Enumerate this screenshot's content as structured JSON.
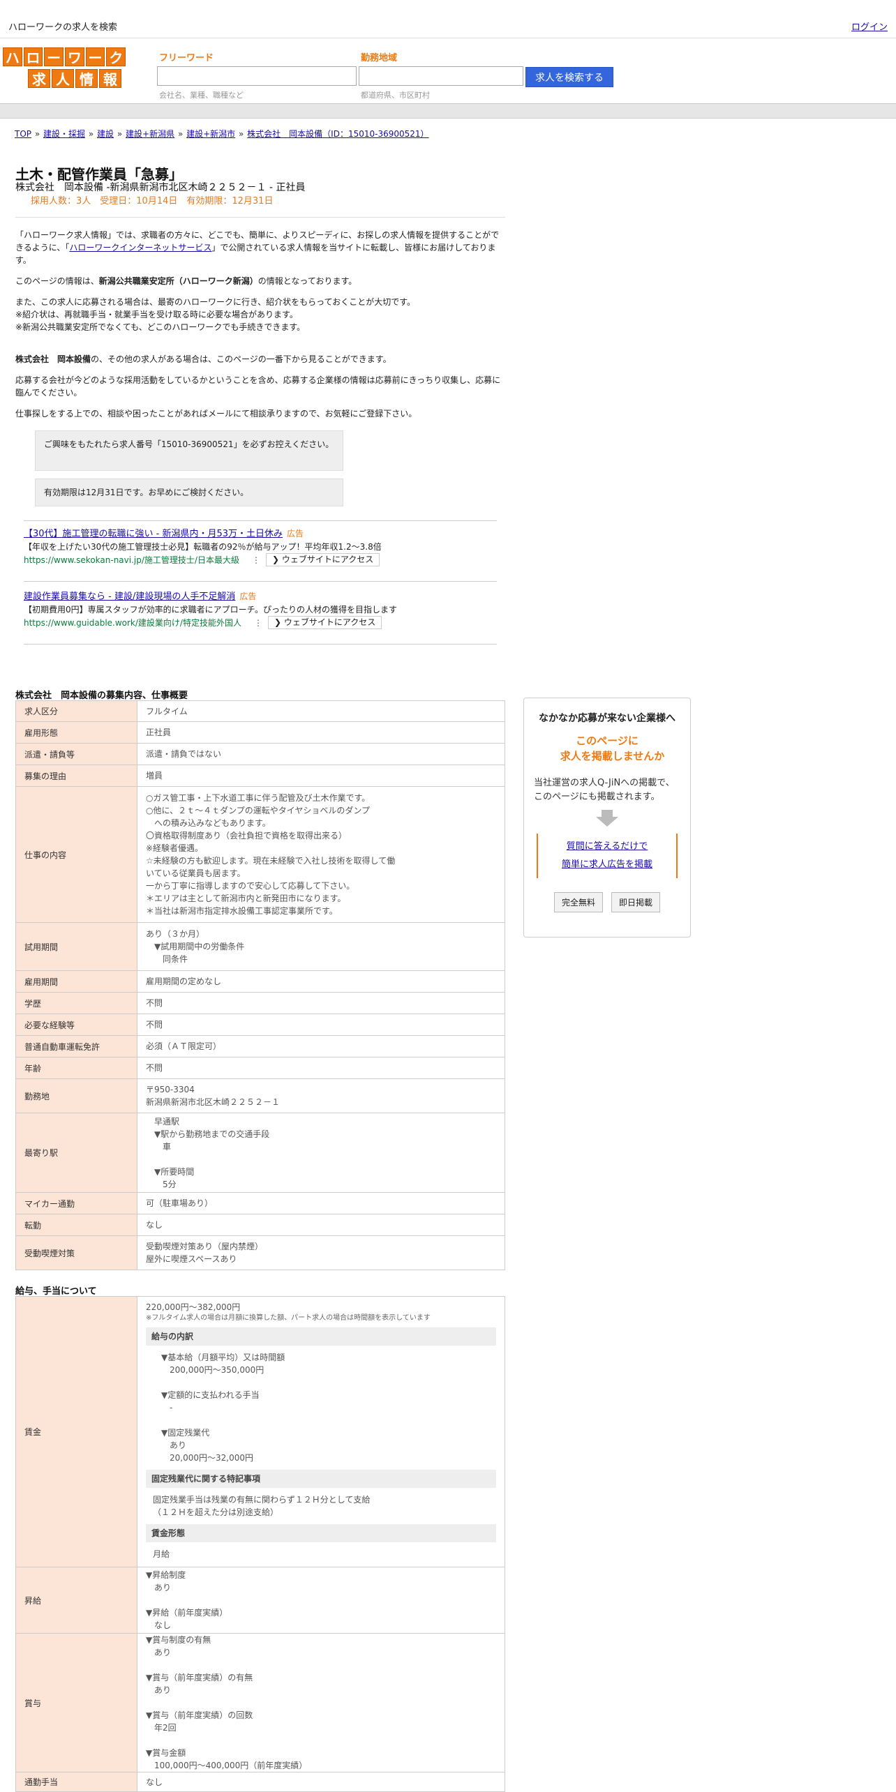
{
  "header": {
    "site_title": "ハローワークの求人を検索",
    "login": "ログイン",
    "logo_row1": [
      "ハ",
      "ロ",
      "ー",
      "ワ",
      "ー",
      "ク"
    ],
    "logo_row2": [
      "求",
      "人",
      "情",
      "報"
    ]
  },
  "search": {
    "keyword_label": "フリーワード",
    "keyword_value": "",
    "keyword_hint": "会社名、業種、職種など",
    "area_label": "勤務地域",
    "area_value": "",
    "area_hint": "都道府県、市区町村",
    "button": "求人を検索する"
  },
  "breadcrumb": {
    "items": [
      "TOP",
      "建設・採掘",
      "建設",
      "建設+新潟県",
      "建設+新潟市",
      "株式会社　岡本設備（ID：15010-36900521）"
    ],
    "sep": "»"
  },
  "job": {
    "title": "土木・配管作業員「急募」",
    "company_line": "株式会社　岡本設備 -新潟県新潟市北区木崎２２５２－１ - 正社員",
    "meta": "採用人数：3人　受理日：10月14日　有効期限：12月31日"
  },
  "intro": {
    "p1_a": "「ハローワーク求人情報」では、求職者の方々に、どこでも、簡単に、よりスピーディに、お探しの求人情報を提供することができるように、「",
    "p1_link": "ハローワークインターネットサービス",
    "p1_b": "」で公開されている求人情報を当サイトに転載し、皆様にお届けしております。",
    "p2_a": "このページの情報は、",
    "p2_bold": "新潟公共職業安定所（ハローワーク新潟）",
    "p2_b": "の情報となっております。",
    "p3": "また、この求人に応募される場合は、最寄のハローワークに行き、紹介状をもらっておくことが大切です。\n※紹介状は、再就職手当・就業手当を受け取る時に必要な場合があります。\n※新潟公共職業安定所でなくても、どこのハローワークでも手続きできます。",
    "p4_bold": "株式会社　岡本設備",
    "p4": "の、その他の求人がある場合は、このページの一番下から見ることができます。",
    "p5": "応募する会社が今どのような採用活動をしているかということを含め、応募する企業様の情報は応募前にきっちり収集し、応募に臨んでください。",
    "p6": "仕事探しをする上での、相談や困ったことがあればメールにて相談承りますので、お気軽にご登録下さい。"
  },
  "notices": [
    "ご興味をもたれたら求人番号「15010-36900521」を必ずお控えください。",
    "有効期限は12月31日です。お早めにご検討ください。"
  ],
  "ads": [
    {
      "title": "【30代】施工管理の転職に強い - 新潟県内・月53万・土日休み",
      "tag": "広告",
      "desc": "【年収を上げたい30代の施工管理技士必見】転職者の92％が給与アップ！平均年収1.2～3.8倍",
      "url": "https://www.sekokan-navi.jp/施工管理技士/日本最大級",
      "visit": "❯ ウェブサイトにアクセス"
    },
    {
      "title": "建設作業員募集なら - 建設/建設現場の人手不足解消",
      "tag": "広告",
      "desc": "【初期費用0円】専属スタッフが効率的に求職者にアプローチ。ぴったりの人材の獲得を目指します",
      "url": "https://www.guidable.work/建設業向け/特定技能外国人",
      "visit": "❯ ウェブサイトにアクセス"
    }
  ],
  "section1": {
    "heading": "株式会社　岡本設備の募集内容、仕事概要",
    "rows": [
      {
        "label": "求人区分",
        "value": "フルタイム"
      },
      {
        "label": "雇用形態",
        "value": "正社員"
      },
      {
        "label": "派遣・請負等",
        "value": "派遣・請負ではない"
      },
      {
        "label": "募集の理由",
        "value": "増員"
      },
      {
        "label": "仕事の内容",
        "value": "○ガス管工事・上下水道工事に伴う配管及び土木作業です。\n○他に、２ｔ～４ｔダンプの運転やタイヤショベルのダンプ\n　への積み込みなどもあります。\n〇資格取得制度あり（会社負担で資格を取得出来る）\n※経験者優遇。\n☆未経験の方も歓迎します。現在未経験で入社し技術を取得して働\nいている従業員も居ます。\n一から丁寧に指導しますので安心して応募して下さい。\n＊エリアは主として新潟市内と新発田市になります。\n＊当社は新潟市指定排水設備工事認定事業所です。"
      },
      {
        "label": "試用期間",
        "value": "あり（３か月）\n　▼試用期間中の労働条件\n　　同条件"
      },
      {
        "label": "雇用期間",
        "value": "雇用期間の定めなし"
      },
      {
        "label": "学歴",
        "value": "不問"
      },
      {
        "label": "必要な経験等",
        "value": "不問"
      },
      {
        "label": "普通自動車運転免許",
        "value": "必須（ＡＴ限定可）"
      },
      {
        "label": "年齢",
        "value": "不問"
      },
      {
        "label": "勤務地",
        "value": "〒950-3304\n新潟県新潟市北区木崎２２５２－１"
      },
      {
        "label": "最寄り駅",
        "value": "　早通駅\n　▼駅から勤務地までの交通手段\n　　車\n\n　▼所要時間\n　　5分"
      },
      {
        "label": "マイカー通勤",
        "value": "可（駐車場あり）"
      },
      {
        "label": "転勤",
        "value": "なし"
      },
      {
        "label": "受動喫煙対策",
        "value": "受動喫煙対策あり（屋内禁煙）\n屋外に喫煙スペースあり"
      }
    ]
  },
  "section2": {
    "heading": "給与、手当について",
    "wage_label": "賃金",
    "wage_range": "220,000円〜382,000円",
    "wage_note": "※フルタイム求人の場合は月額に換算した額、パート求人の場合は時間額を表示しています",
    "breakdown_h": "給与の内訳",
    "breakdown": "▼基本給（月額平均）又は時間額\n　200,000円〜350,000円\n\n▼定額的に支払われる手当\n　-\n\n▼固定残業代\n　あり\n　20,000円〜32,000円",
    "fixed_h": "固定残業代に関する特記事項",
    "fixed": "固定残業手当は残業の有無に関わらず１２Ｈ分として支給\n（１２Ｈを超えた分は別途支給）",
    "form_h": "賃金形態",
    "form": "月給",
    "raise_label": "昇給",
    "raise": "▼昇給制度\n　あり\n\n▼昇給（前年度実績）\n　なし",
    "bonus_label": "賞与",
    "bonus": "▼賞与制度の有無\n　あり\n\n▼賞与（前年度実績）の有無\n　あり\n\n▼賞与（前年度実績）の回数\n　年2回\n\n▼賞与金額\n　100,000円〜400,000円（前年度実績）",
    "commute_label": "通勤手当",
    "commute": "なし"
  },
  "sidebar": {
    "t1": "なかなか応募が来ない企業様へ",
    "t2": "このページに\n　求人を掲載しませんか",
    "t3": "当社運営の求人Q-JiNへの掲載で、このページにも掲載されます。",
    "link1": "質問に答えるだけで",
    "link2": "簡単に求人広告を掲載",
    "btn1": "完全無料",
    "btn2": "即日掲載"
  }
}
